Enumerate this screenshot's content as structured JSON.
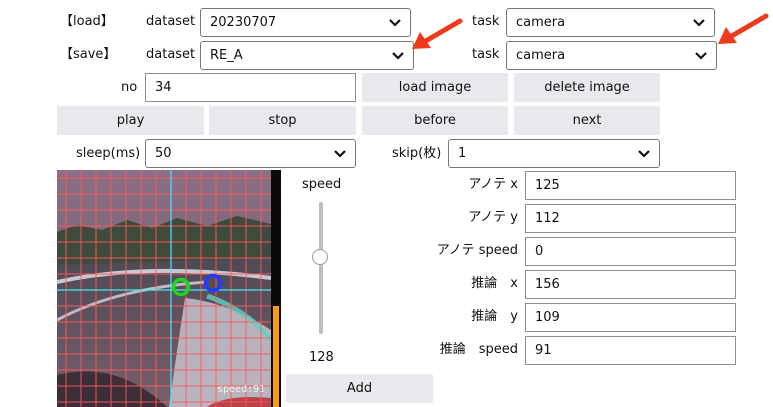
{
  "load_row": {
    "tag": "【load】",
    "dataset_label": "dataset",
    "dataset_value": "20230707",
    "task_label": "task",
    "task_value": "camera"
  },
  "save_row": {
    "tag": "【save】",
    "dataset_label": "dataset",
    "dataset_value": "RE_A",
    "task_label": "task",
    "task_value": "camera"
  },
  "no": {
    "label": "no",
    "value": "34"
  },
  "buttons": {
    "load_image": "load image",
    "delete_image": "delete image",
    "play": "play",
    "stop": "stop",
    "before": "before",
    "next": "next",
    "add": "Add"
  },
  "sleep": {
    "label": "sleep(ms)",
    "value": "50"
  },
  "skip": {
    "label": "skip(枚)",
    "value": "1"
  },
  "speed_slider": {
    "label": "speed",
    "value": "128",
    "level_fraction": 0.5
  },
  "camera_view": {
    "overlay_text": "speed:91",
    "markers": [
      "green-circle",
      "blue-circle"
    ],
    "grid_color": "#ff5a5a",
    "crosshair_color": "#47e6ff"
  },
  "annotation": {
    "x_label": "アノテ x",
    "x_value": "125",
    "y_label": "アノテ y",
    "y_value": "112",
    "speed_label": "アノテ speed",
    "speed_value": "0"
  },
  "inference": {
    "x_label": "推論　x",
    "x_value": "156",
    "y_label": "推論　y",
    "y_value": "109",
    "speed_label": "推論　speed",
    "speed_value": "91"
  },
  "colors": {
    "arrow": "#ee3a1c",
    "button_bg": "#e9e9ed",
    "orange_bar": "#f39c12"
  }
}
